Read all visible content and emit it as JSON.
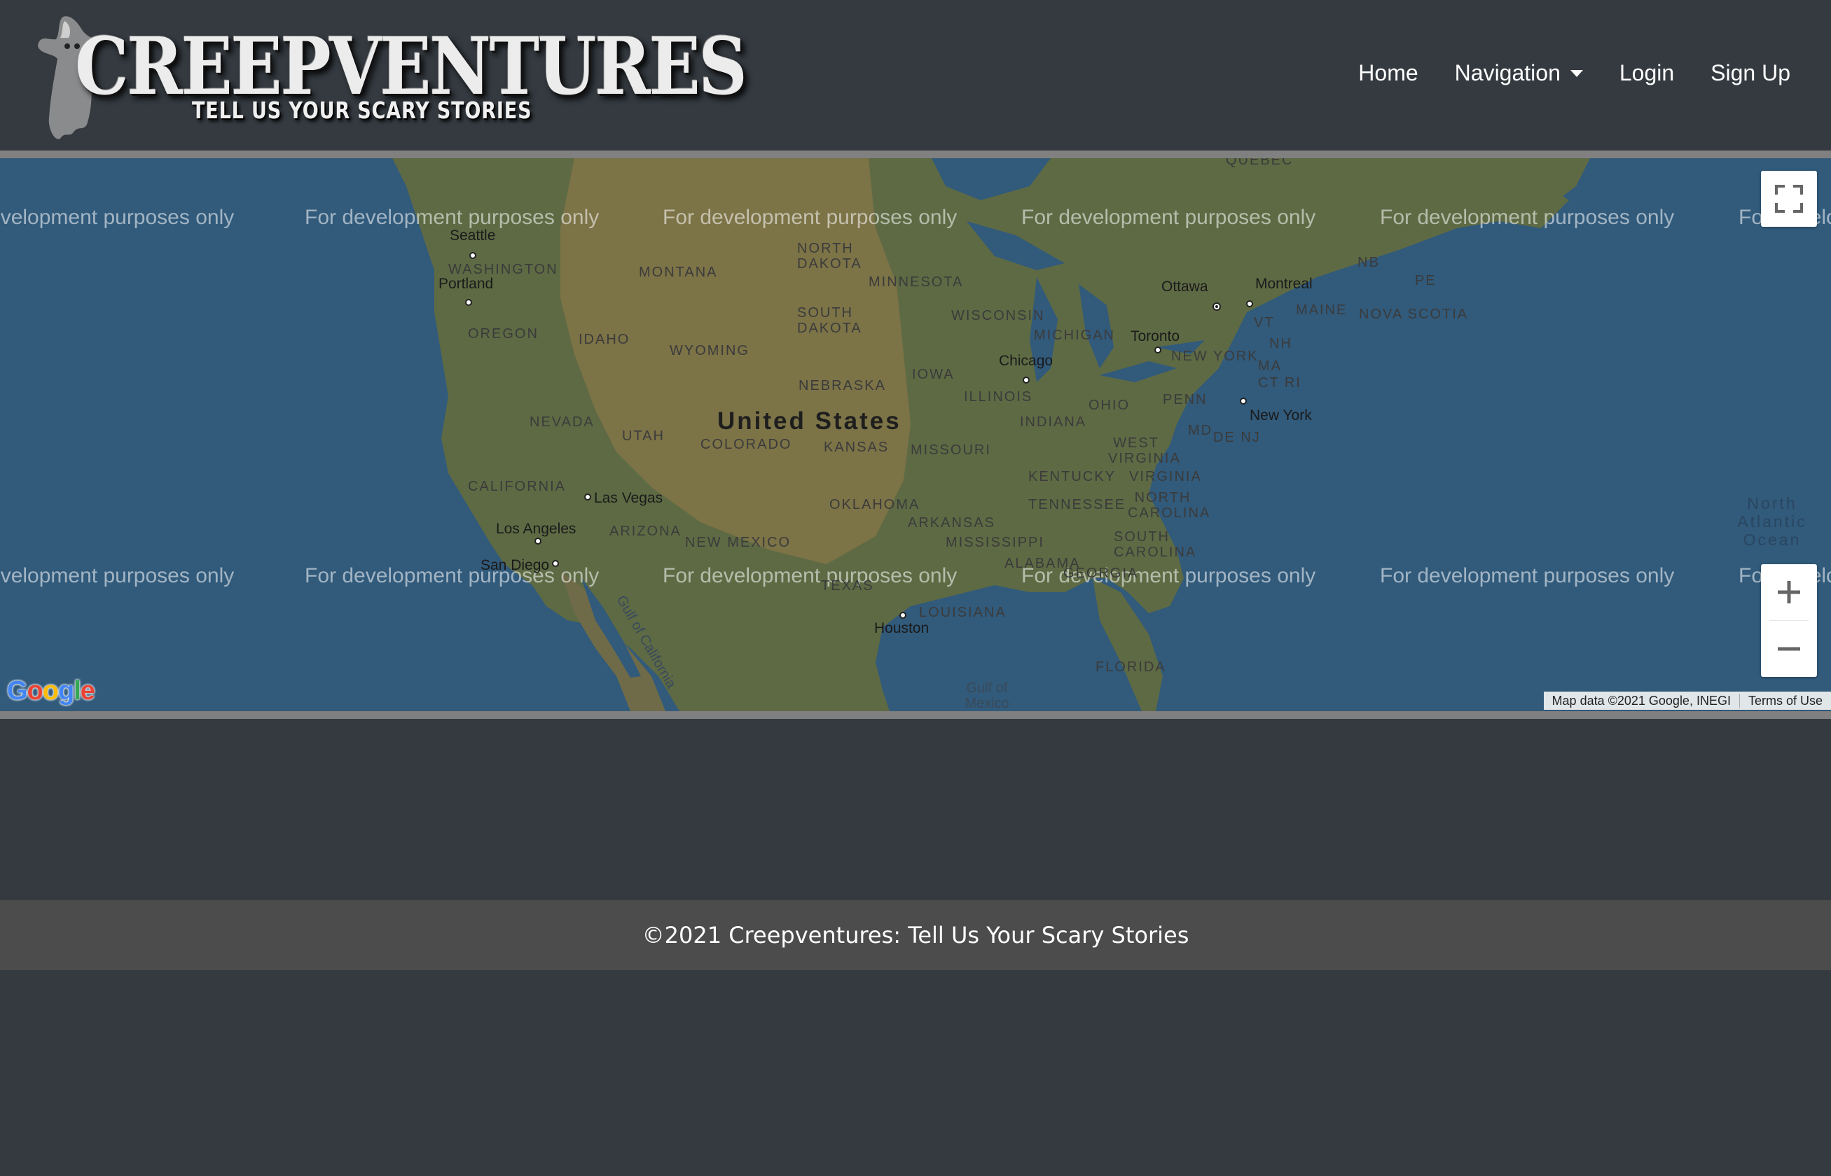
{
  "header": {
    "logo_title": "CREEPVENTURES",
    "logo_tagline": "TELL US YOUR SCARY STORIES",
    "nav": {
      "home": "Home",
      "navigation": "Navigation",
      "login": "Login",
      "signup": "Sign Up"
    }
  },
  "map": {
    "watermark": "For development purposes only",
    "country_label": "United States",
    "state_labels": [
      "WASHINGTON",
      "MONTANA",
      "NORTH DAKOTA",
      "MINNESOTA",
      "OREGON",
      "IDAHO",
      "WYOMING",
      "SOUTH DAKOTA",
      "WISCONSIN",
      "MICHIGAN",
      "NEBRASKA",
      "IOWA",
      "ILLINOIS",
      "INDIANA",
      "OHIO",
      "PENN",
      "NEVADA",
      "UTAH",
      "COLORADO",
      "KANSAS",
      "MISSOURI",
      "CALIFORNIA",
      "KENTUCKY",
      "VIRGINIA",
      "WEST VIRGINIA",
      "OKLAHOMA",
      "TENNESSEE",
      "NORTH CAROLINA",
      "ARKANSAS",
      "ARIZONA",
      "NEW MEXICO",
      "MISSISSIPPI",
      "ALABAMA",
      "SOUTH CAROLINA",
      "GEORGIA",
      "TEXAS",
      "LOUISIANA",
      "FLORIDA",
      "NEW YORK",
      "MAINE",
      "NOVA SCOTIA",
      "NB",
      "PE",
      "VT",
      "NH",
      "MA",
      "CT RI",
      "MD",
      "DE NJ",
      "QUEBEC"
    ],
    "cities": [
      "Seattle",
      "Portland",
      "Chicago",
      "Toronto",
      "Ottawa",
      "Montreal",
      "New York",
      "Las Vegas",
      "Los Angeles",
      "San Diego",
      "Houston"
    ],
    "ocean_label": "North Atlantic Ocean",
    "gulf_mexico": "Gulf of Mexico",
    "gulf_california": "Gulf of California",
    "fullscreen_icon": "fullscreen-icon",
    "zoom_in_icon": "plus-icon",
    "zoom_out_icon": "minus-icon",
    "google_logo": "Google",
    "attribution": "Map data ©2021 Google, INEGI",
    "terms": "Terms of Use",
    "colors": {
      "water": "#315a7b",
      "land": "#5e6a44",
      "plains": "#7c7347"
    }
  },
  "footer": {
    "text": "©2021 Creepventures: Tell Us Your Scary Stories"
  },
  "colors": {
    "page_bg": "#343a40",
    "footer_bg": "#4c4c4c",
    "map_frame": "#808080"
  }
}
